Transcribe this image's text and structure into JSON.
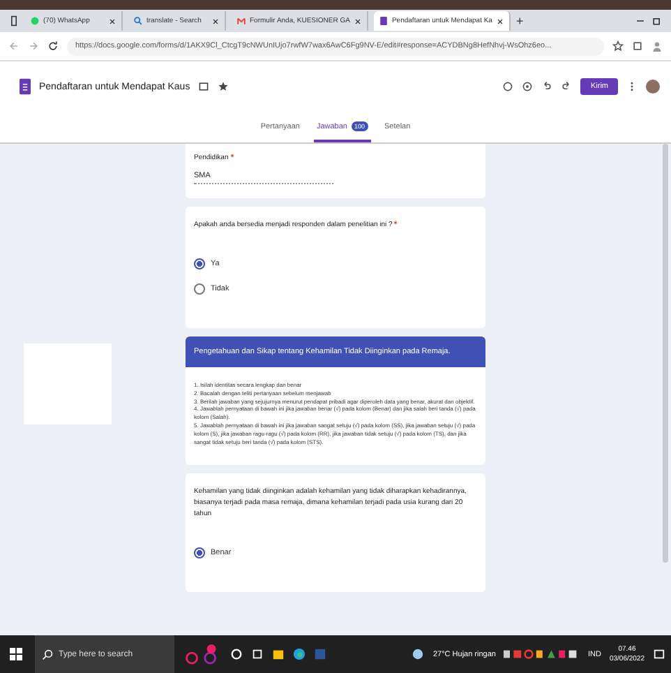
{
  "browser_tabs": [
    {
      "label": "(70) WhatsApp",
      "selected": false
    },
    {
      "label": "translate - Search",
      "selected": false
    },
    {
      "label": "Formulir Anda, KUESIONER GA",
      "selected": false
    },
    {
      "label": "Pendaftaran untuk Mendapat Ka",
      "selected": true
    }
  ],
  "new_tab": "+",
  "address_bar": {
    "url": "https://docs.google.com/forms/d/1AKX9Cl_CtcgT9cNWUnIUjo7rwfW7wax6AwC6Fg9NV-E/edit#response=ACYDBNg8HefNhvj-WsOhz6eo..."
  },
  "form_header": {
    "title": "Pendaftaran untuk Mendapat Kaus",
    "send_button": "Kirim"
  },
  "form_tabs": [
    {
      "label": "Pertanyaan",
      "selected": false
    },
    {
      "label": "Jawaban",
      "selected": true,
      "badge": "100"
    },
    {
      "label": "Setelan",
      "selected": false
    }
  ],
  "cards": [
    {
      "kind": "text",
      "question": "Pendidikan",
      "required": true,
      "answer": "SMA"
    },
    {
      "kind": "radio",
      "question": "Apakah anda bersedia menjadi responden dalam penelitian ini ?",
      "required": true,
      "options": [
        {
          "label": "Ya",
          "selected": true
        },
        {
          "label": "Tidak",
          "selected": false
        }
      ]
    },
    {
      "kind": "section",
      "title": "Pengetahuan dan Sikap tentang Kehamilan Tidak Diinginkan pada Remaja.",
      "lines": [
        "1.   Isilah identitas secara lengkap dan benar",
        "2.   Bacalah dengan teliti pertanyaan sebelum menjawab",
        "3.   Berilah jawaban yang sejujurnya menurut pendapat pribadi agar diperoleh data yang benar, akurat dan objektif.",
        "4. Jawablah pernyataan di bawah ini jika jawaban benar (√) pada kolom (Benar) dan jika salah beri tanda (√) pada kolom (Salah).",
        "5.  Jawablah pernyataan di bawah ini jika jawaban sangat setuju (√) pada kolom (SS), jika jawaban setuju (√) pada kolom (S), jika jawaban ragu-ragu (√) pada kolom (RR), jika jawaban tidak setuju (√) pada kolom (TS), dan jika sangat tidak setuju beri tanda (√) pada kolom (STS)."
      ]
    },
    {
      "kind": "radio",
      "question": "Kehamilan yang tidak diinginkan adalah kehamilan yang tidak diharapkan kehadirannya, biasanya terjadi pada masa remaja, dimana kehamilan terjadi pada usia kurang dari 20 tahun",
      "required": false,
      "options": [
        {
          "label": "Benar",
          "selected": true
        }
      ]
    }
  ],
  "taskbar": {
    "search_placeholder": "Type here to search",
    "weather": "27°C  Hujan ringan",
    "language": "IND",
    "time": "07.46",
    "date": "03/06/2022"
  }
}
